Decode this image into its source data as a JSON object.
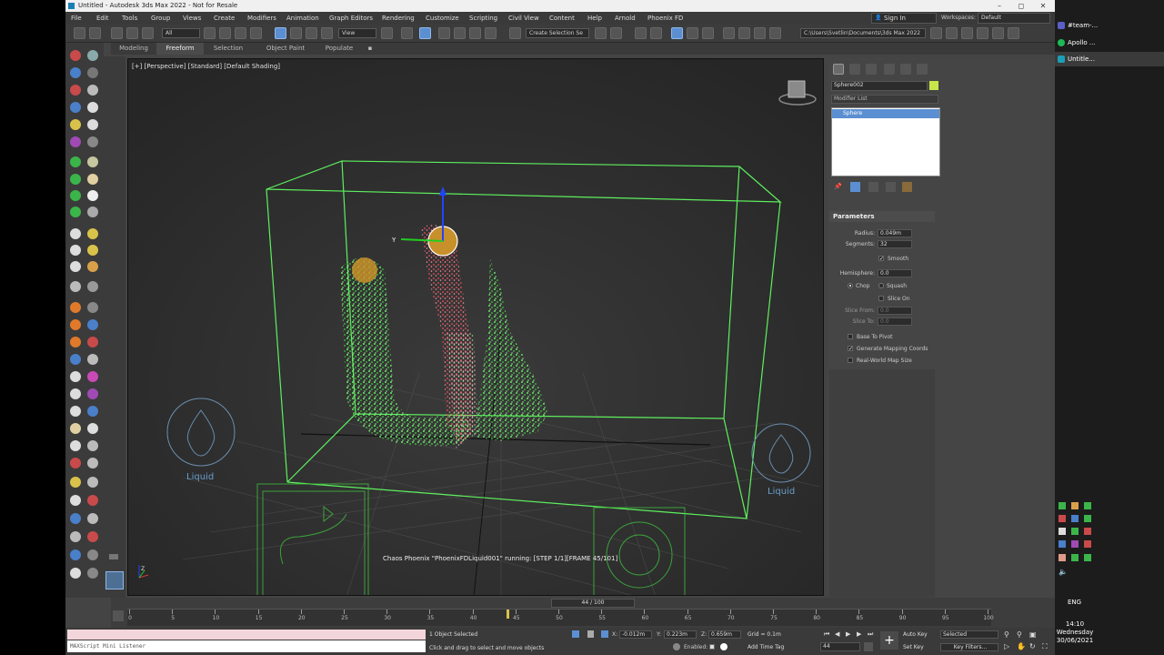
{
  "window": {
    "title": "Untitled - Autodesk 3ds Max 2022 - Not for Resale",
    "controls": [
      "–",
      "◻",
      "✕"
    ]
  },
  "menu": [
    "File",
    "Edit",
    "Tools",
    "Group",
    "Views",
    "Create",
    "Modifiers",
    "Animation",
    "Graph Editors",
    "Rendering",
    "Customize",
    "Scripting",
    "Civil View",
    "Content",
    "Help",
    "Arnold",
    "Phoenix FD"
  ],
  "account": {
    "sign_in": "Sign In",
    "workspaces_label": "Workspaces:",
    "workspace_value": "Default"
  },
  "toolbar": {
    "filter_value": "All",
    "view_value": "View",
    "selection_set_placeholder": "Create Selection Se",
    "project_path": "C:\\Users\\Svetlin\\Documents\\3ds Max 2022"
  },
  "ribbon_tabs": [
    "Modeling",
    "Freeform",
    "Selection",
    "Object Paint",
    "Populate"
  ],
  "viewport": {
    "label": "[+] [Perspective] [Standard] [Default Shading]",
    "sim_status": "Chaos Phoenix \"PhoenixFDLiquid001\" running: [STEP 1/1][FRAME 45/101]",
    "overlay_label_left": "Liquid",
    "overlay_label_right": "Liquid",
    "gizmo_axis_y": "Y",
    "gizmo_axis_z": "Z"
  },
  "command_panel": {
    "object_name": "Sphere002",
    "object_color": "#c8e64a",
    "modifier_list": "Modifier List",
    "stack_item": "Sphere",
    "rollout_title": "Parameters",
    "params": {
      "radius_label": "Radius:",
      "radius_value": "0.049m",
      "segments_label": "Segments:",
      "segments_value": "32",
      "smooth_label": "Smooth",
      "hemisphere_label": "Hemisphere:",
      "hemisphere_value": "0.0",
      "chop_label": "Chop",
      "squash_label": "Squash",
      "slice_on_label": "Slice On",
      "slice_from_label": "Slice From:",
      "slice_from_value": "0.0",
      "slice_to_label": "Slice To:",
      "slice_to_value": "0.0",
      "base_to_pivot_label": "Base To Pivot",
      "gen_mapping_label": "Generate Mapping Coords",
      "real_world_label": "Real-World Map Size"
    }
  },
  "timeline": {
    "frame_display": "44 / 100",
    "ticks": [
      "0",
      "5",
      "10",
      "15",
      "20",
      "25",
      "30",
      "35",
      "40",
      "45",
      "50",
      "55",
      "60",
      "65",
      "70",
      "75",
      "80",
      "85",
      "90",
      "95",
      "100"
    ],
    "current_frame": 44,
    "total_frames": 100
  },
  "status": {
    "maxscript": "MAXScript Mini Listener",
    "selection_info": "1 Object Selected",
    "prompt": "Click and drag to select and move objects",
    "x_label": "X:",
    "x_value": "-0.012m",
    "y_label": "Y:",
    "y_value": "0.223m",
    "z_label": "Z:",
    "z_value": "0.659m",
    "grid": "Grid = 0.1m",
    "enabled": "Enabled:",
    "add_time_tag": "Add Time Tag",
    "auto_key": "Auto Key",
    "set_key": "Set Key",
    "key_selected": "Selected",
    "key_filters": "Key Filters...",
    "frame_field": "44"
  },
  "taskbar": {
    "items": [
      "#team-...",
      "Apollo ...",
      "Untitle..."
    ],
    "lang": "ENG",
    "time": "14:10",
    "day": "Wednesday",
    "date": "30/06/2021"
  },
  "colors": {
    "particles_green": "#5ef05e",
    "particles_red": "#ff4a5a",
    "box_outline": "#5ef05e",
    "selection_blue": "#5b8fd1"
  }
}
